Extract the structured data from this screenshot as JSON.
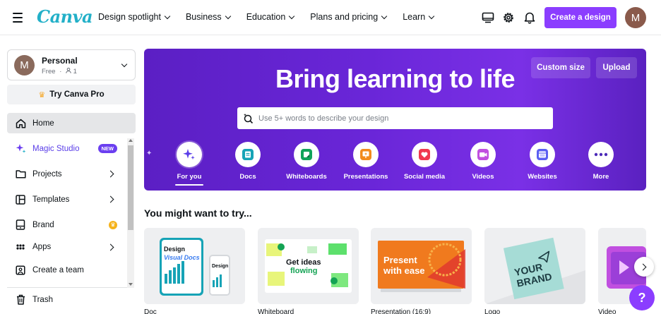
{
  "header": {
    "logo": "Canva",
    "nav": [
      {
        "label": "Design spotlight"
      },
      {
        "label": "Business"
      },
      {
        "label": "Education"
      },
      {
        "label": "Plans and pricing"
      },
      {
        "label": "Learn"
      }
    ],
    "create_label": "Create a design",
    "avatar_initial": "M"
  },
  "sidebar": {
    "team": {
      "initial": "M",
      "name": "Personal",
      "plan": "Free",
      "members": "1"
    },
    "pro_label": "Try Canva Pro",
    "items": [
      {
        "label": "Home"
      },
      {
        "label": "Magic Studio",
        "badge": "NEW"
      },
      {
        "label": "Projects"
      },
      {
        "label": "Templates"
      },
      {
        "label": "Brand"
      },
      {
        "label": "Apps"
      },
      {
        "label": "Create a team"
      },
      {
        "label": "Trash"
      }
    ]
  },
  "hero": {
    "title": "Bring learning to life",
    "custom_size": "Custom size",
    "upload": "Upload",
    "search_placeholder": "Use 5+ words to describe your design",
    "categories": [
      {
        "label": "For you",
        "icon": "sparkle-icon",
        "color": "#5a3ee8"
      },
      {
        "label": "Docs",
        "icon": "doc-icon",
        "color": "#16a3b6"
      },
      {
        "label": "Whiteboards",
        "icon": "whiteboard-icon",
        "color": "#12a35a"
      },
      {
        "label": "Presentations",
        "icon": "presentation-icon",
        "color": "#f28a1d"
      },
      {
        "label": "Social media",
        "icon": "heart-icon",
        "color": "#f0384e"
      },
      {
        "label": "Videos",
        "icon": "video-icon",
        "color": "#c04fe0"
      },
      {
        "label": "Websites",
        "icon": "website-icon",
        "color": "#5b5ff2"
      },
      {
        "label": "More",
        "icon": "more-icon",
        "color": "#4c2ab8"
      }
    ]
  },
  "suggestions": {
    "title": "You might want to try...",
    "cards": [
      {
        "label": "Doc",
        "art_line1": "Design",
        "art_line2": "Visual Docs"
      },
      {
        "label": "Whiteboard",
        "art_line1": "Get ideas",
        "art_line2": "flowing"
      },
      {
        "label": "Presentation (16:9)",
        "art_line1": "Present",
        "art_line2": "with ease"
      },
      {
        "label": "Logo",
        "art_line1": "YOUR",
        "art_line2": "BRAND"
      },
      {
        "label": "Video"
      }
    ]
  },
  "help_label": "?"
}
